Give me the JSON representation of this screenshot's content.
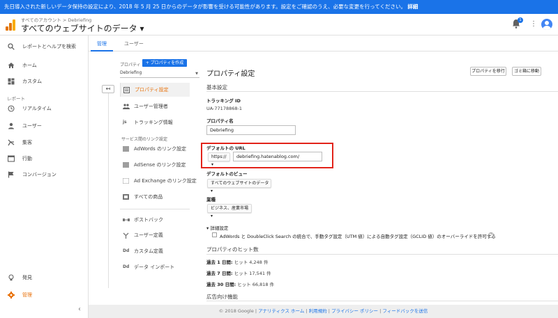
{
  "banner": {
    "text": "先日導入された新しいデータ保持の設定により、2018 年 5 月 25 日からのデータが影響を受ける可能性があります。設定をご確認のうえ、必要な変更を行ってください。",
    "link": "詳細"
  },
  "header": {
    "breadcrumb": "すべてのアカウント > Debriefing",
    "view_title": "すべてのウェブサイトのデータ ▾",
    "bell_badge": "1",
    "kebab": "⋮",
    "logo_colors": [
      "#f9ab00",
      "#e37400",
      "#e37400"
    ]
  },
  "leftnav": {
    "search": "レポートとヘルプを検索",
    "home": "ホーム",
    "custom": "カスタム",
    "reports_heading": "レポート",
    "realtime": "リアルタイム",
    "audience": "ユーザー",
    "acquisition": "集客",
    "behavior": "行動",
    "conversions": "コンバージョン",
    "discover": "発見",
    "admin": "管理",
    "collapse": "‹"
  },
  "tabs": {
    "admin": "管理",
    "user": "ユーザー"
  },
  "property_column": {
    "label": "プロパティ",
    "create_button": "+ プロパティを作成",
    "selected": "Debriefing",
    "back_arrow": "↤",
    "items": {
      "property_settings": "プロパティ設定",
      "user_management": "ユーザー管理者",
      "tracking_info": "トラッキング情報",
      "product_linking_heading": "サービス間のリンク設定",
      "adwords": "AdWords のリンク設定",
      "adsense": "AdSense のリンク設定",
      "adexchange": "Ad Exchange のリンク設定",
      "all_products": "すべての商品",
      "postbacks": "ポストバック",
      "audience_definitions": "ユーザー定義",
      "custom_definitions": "カスタム定義",
      "data_import": "データ インポート"
    },
    "icons": {
      "js": "js",
      "dd": "Dd"
    }
  },
  "settings": {
    "title": "プロパティ設定",
    "move_property_button": "プロパティを移行",
    "trash_button": "ゴミ箱に移動",
    "basic_heading": "基本設定",
    "tracking_id_label": "トラッキング ID",
    "tracking_id_value": "UA-77178868-1",
    "property_name_label": "プロパティ名",
    "property_name_value": "Debriefing",
    "default_url_label": "デフォルトの URL",
    "protocol_value": "https:// ▾",
    "default_url_value": "debriefing.hatenablog.com/",
    "default_view_label": "デフォルトのビュー",
    "default_view_value": "すべてのウェブサイトのデータ ▾",
    "industry_label": "業種",
    "industry_value": "ビジネス、産業市場 ▾",
    "advanced_toggle": "▾ 詳細設定",
    "advanced_checkbox_text": "AdWords と DoubleClick Search の統合で、手動タグ設定（UTM 値）による自動タグ設定（GCLID 値）のオーバーライドを許可する",
    "hits_heading": "プロパティのヒット数",
    "hits": [
      {
        "label": "過去 1 日間:",
        "value": "ヒット 4,248 件"
      },
      {
        "label": "過去 7 日間:",
        "value": "ヒット 17,541 件"
      },
      {
        "label": "過去 30 日間:",
        "value": "ヒット 66,818 件"
      }
    ],
    "ad_features_heading": "広告向け機能"
  },
  "footer": {
    "copyright": "© 2018 Google |",
    "links": [
      "アナリティクス ホーム",
      "利用規約",
      "プライバシー ポリシー",
      "フィードバックを送信"
    ],
    "sep": "|"
  },
  "colors": {
    "accent_blue": "#1a73e8",
    "active_orange": "#e8710a",
    "highlight_red": "#e2231a"
  }
}
